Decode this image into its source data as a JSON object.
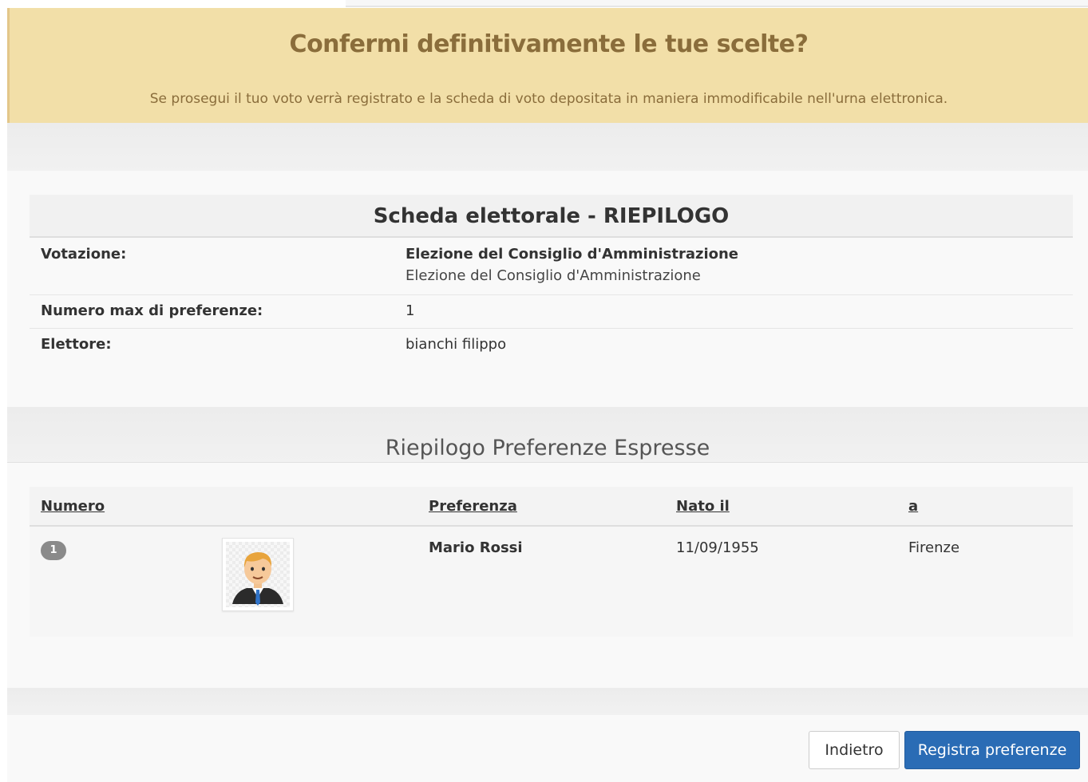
{
  "alert": {
    "title": "Confermi definitivamente le tue scelte?",
    "message": "Se prosegui il tuo voto verrà registrato e la scheda di voto depositata in maniera immodificabile nell'urna elettronica."
  },
  "summary": {
    "title": "Scheda elettorale - RIEPILOGO",
    "rows": [
      {
        "label": "Votazione:",
        "value": "Elezione del Consiglio d'Amministrazione",
        "subvalue": "Elezione del Consiglio d'Amministrazione"
      },
      {
        "label": "Numero max di preferenze:",
        "value": "1"
      },
      {
        "label": "Elettore:",
        "value": "bianchi filippo"
      }
    ]
  },
  "preferences": {
    "title": "Riepilogo Preferenze Espresse",
    "columns": [
      "Numero",
      "Preferenza",
      "Nato il",
      "a"
    ],
    "rows": [
      {
        "number": "1",
        "avatar_icon": "user-avatar-icon",
        "name": "Mario Rossi",
        "birth_date": "11/09/1955",
        "birth_place": "Firenze"
      }
    ]
  },
  "actions": {
    "back_label": "Indietro",
    "save_label": "Registra preferenze"
  },
  "colors": {
    "alert_bg": "#f2dfa8",
    "alert_text": "#8a6d3b",
    "primary": "#2a6cb5"
  }
}
